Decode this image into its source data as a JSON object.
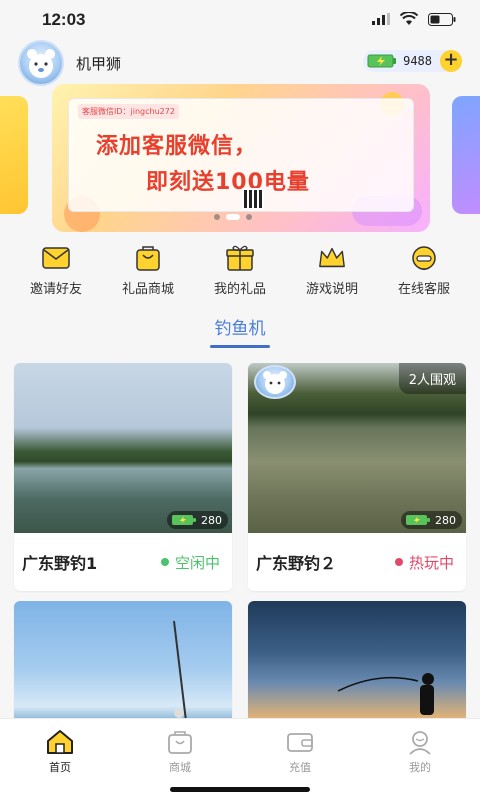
{
  "status_bar": {
    "time": "12:03"
  },
  "header": {
    "username": "机甲狮",
    "energy_count": "9488",
    "add_label": "+"
  },
  "banner": {
    "tag": "客服微信ID：jingchu272",
    "line1": "添加客服微信，",
    "line2": "即刻送100电量"
  },
  "quick_menu": [
    {
      "label": "邀请好友",
      "icon": "envelope-icon"
    },
    {
      "label": "礼品商城",
      "icon": "shopping-bag-icon"
    },
    {
      "label": "我的礼品",
      "icon": "gift-icon"
    },
    {
      "label": "游戏说明",
      "icon": "crown-icon"
    },
    {
      "label": "在线客服",
      "icon": "headset-icon"
    }
  ],
  "section": {
    "title": "钓鱼机"
  },
  "cards": [
    {
      "name": "广东野钓1",
      "status": "空闲中",
      "status_color": "#4cc26c",
      "energy": "280",
      "watchers": ""
    },
    {
      "name": "广东野钓２",
      "status": "热玩中",
      "status_color": "#e04a6a",
      "energy": "280",
      "watchers": "2人围观"
    },
    {
      "name": "",
      "status": "",
      "energy": "",
      "watchers": ""
    },
    {
      "name": "",
      "status": "",
      "energy": "",
      "watchers": ""
    }
  ],
  "tabs": [
    {
      "label": "首页",
      "icon": "home-icon",
      "active": true
    },
    {
      "label": "商城",
      "icon": "shop-icon",
      "active": false
    },
    {
      "label": "充值",
      "icon": "wallet-icon",
      "active": false
    },
    {
      "label": "我的",
      "icon": "profile-icon",
      "active": false
    }
  ],
  "colors": {
    "accent": "#4a7ed8",
    "energy_yellow": "#ffd22e",
    "idle": "#4cc26c",
    "busy": "#e04a6a"
  }
}
